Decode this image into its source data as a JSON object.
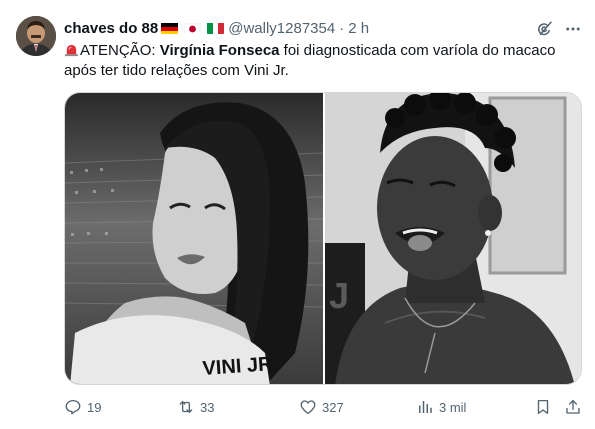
{
  "tweet": {
    "display_name": "chaves do 88",
    "handle": "@wally1287354",
    "separator": "·",
    "time": "2 h",
    "text_prefix": "ATENÇÃO: ",
    "text_bold": "Virgínia Fonseca",
    "text_rest": " foi diagnosticada com varíola do macaco após ter tido relações com Vini Jr.",
    "flags": [
      "flag-germany",
      "flag-japan",
      "flag-italy"
    ]
  },
  "media": {
    "left_caption": "VINI JR.",
    "left_image": "woman-photo-bw",
    "right_image": "man-photo-bw"
  },
  "actions": {
    "replies": "19",
    "reposts": "33",
    "likes": "327",
    "views": "3 mil"
  },
  "icons": {
    "reply": "reply-icon",
    "repost": "repost-icon",
    "like": "heart-icon",
    "views": "views-icon",
    "bookmark": "bookmark-icon",
    "share": "share-icon",
    "grok": "grok-icon",
    "more": "more-icon"
  },
  "colors": {
    "text": "#0f1419",
    "secondary": "#536471",
    "border": "#cfd9de"
  }
}
